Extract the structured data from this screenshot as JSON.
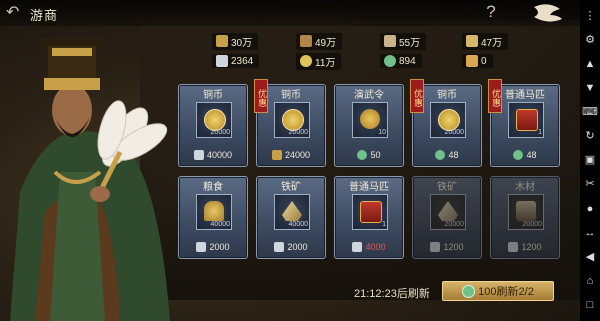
{
  "header": {
    "title": "游商",
    "help_label": "?"
  },
  "resources": [
    {
      "icon": "food-icon",
      "value": "30万"
    },
    {
      "icon": "wood-icon",
      "value": "49万"
    },
    {
      "icon": "stone-icon",
      "value": "55万"
    },
    {
      "icon": "iron-icon",
      "value": "47万"
    },
    {
      "icon": "silver-icon",
      "value": "2364"
    },
    {
      "icon": "coin-icon",
      "value": "11万"
    },
    {
      "icon": "jade-icon",
      "value": "894"
    },
    {
      "icon": "token-icon",
      "value": "0"
    }
  ],
  "items": [
    {
      "name": "铜币",
      "qty": "20000",
      "price": "40000",
      "currency": "silver",
      "tag": "",
      "sold_out": false,
      "icon": "copper-coin-icon"
    },
    {
      "name": "铜币",
      "qty": "20000",
      "price": "24000",
      "currency": "wood",
      "tag": "优惠",
      "sold_out": false,
      "icon": "copper-coin-icon"
    },
    {
      "name": "演武令",
      "qty": "10",
      "price": "50",
      "currency": "jade",
      "tag": "",
      "sold_out": false,
      "icon": "drill-token-icon"
    },
    {
      "name": "铜币",
      "qty": "20000",
      "price": "48",
      "currency": "jade",
      "tag": "优惠",
      "sold_out": false,
      "icon": "copper-coin-icon"
    },
    {
      "name": "普通马匹",
      "qty": "1",
      "price": "48",
      "currency": "jade",
      "tag": "优惠",
      "sold_out": false,
      "icon": "horse-crate-icon"
    },
    {
      "name": "粮食",
      "qty": "40000",
      "price": "2000",
      "currency": "silver",
      "tag": "",
      "sold_out": false,
      "icon": "grain-icon"
    },
    {
      "name": "铁矿",
      "qty": "40000",
      "price": "2000",
      "currency": "silver",
      "tag": "",
      "sold_out": false,
      "icon": "iron-ore-icon"
    },
    {
      "name": "普通马匹",
      "qty": "1",
      "price": "4000",
      "currency": "silver",
      "tag": "",
      "sold_out": false,
      "icon": "horse-crate-icon"
    },
    {
      "name": "铁矿",
      "qty": "20000",
      "price": "1200",
      "currency": "silver",
      "tag": "",
      "sold_out": true,
      "icon": "iron-ore-icon"
    },
    {
      "name": "木材",
      "qty": "20000",
      "price": "1200",
      "currency": "silver",
      "tag": "",
      "sold_out": true,
      "icon": "wood-log-icon"
    }
  ],
  "footer": {
    "timer": "21:12:23后刷新",
    "refresh_label": "100刷新2/2"
  },
  "colors": {
    "gold": "#d7b46a",
    "card_blue": "#4a5a72",
    "tag_red": "#9c1c1c",
    "jade_green": "#6fc08a"
  }
}
